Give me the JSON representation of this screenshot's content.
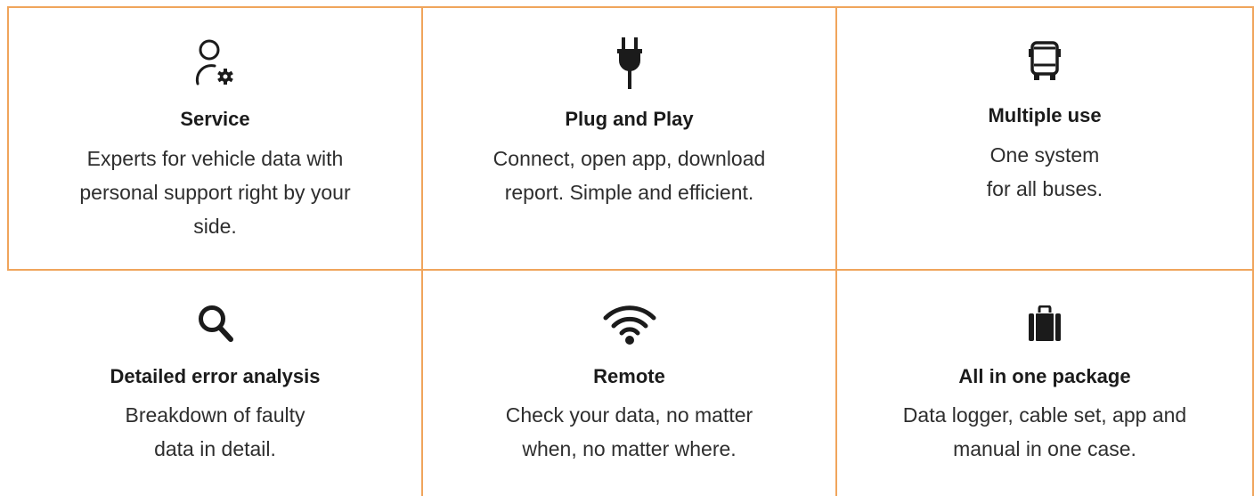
{
  "colors": {
    "accent": "#f0a55c",
    "text": "#1b1b1b"
  },
  "features": [
    {
      "icon": "user-gear-icon",
      "title": "Service",
      "description": "Experts for vehicle data with\npersonal support right by your\nside."
    },
    {
      "icon": "plug-icon",
      "title": "Plug and Play",
      "description": "Connect, open app, download\nreport. Simple and efficient."
    },
    {
      "icon": "bus-icon",
      "title": "Multiple use",
      "description": "One system\nfor all buses."
    },
    {
      "icon": "magnifier-icon",
      "title": "Detailed error analysis",
      "description": "Breakdown of faulty\ndata in detail."
    },
    {
      "icon": "wifi-icon",
      "title": "Remote",
      "description": "Check your data, no matter\nwhen, no matter where."
    },
    {
      "icon": "suitcase-icon",
      "title": "All in one package",
      "description": "Data logger, cable set, app and\nmanual in one case."
    }
  ]
}
